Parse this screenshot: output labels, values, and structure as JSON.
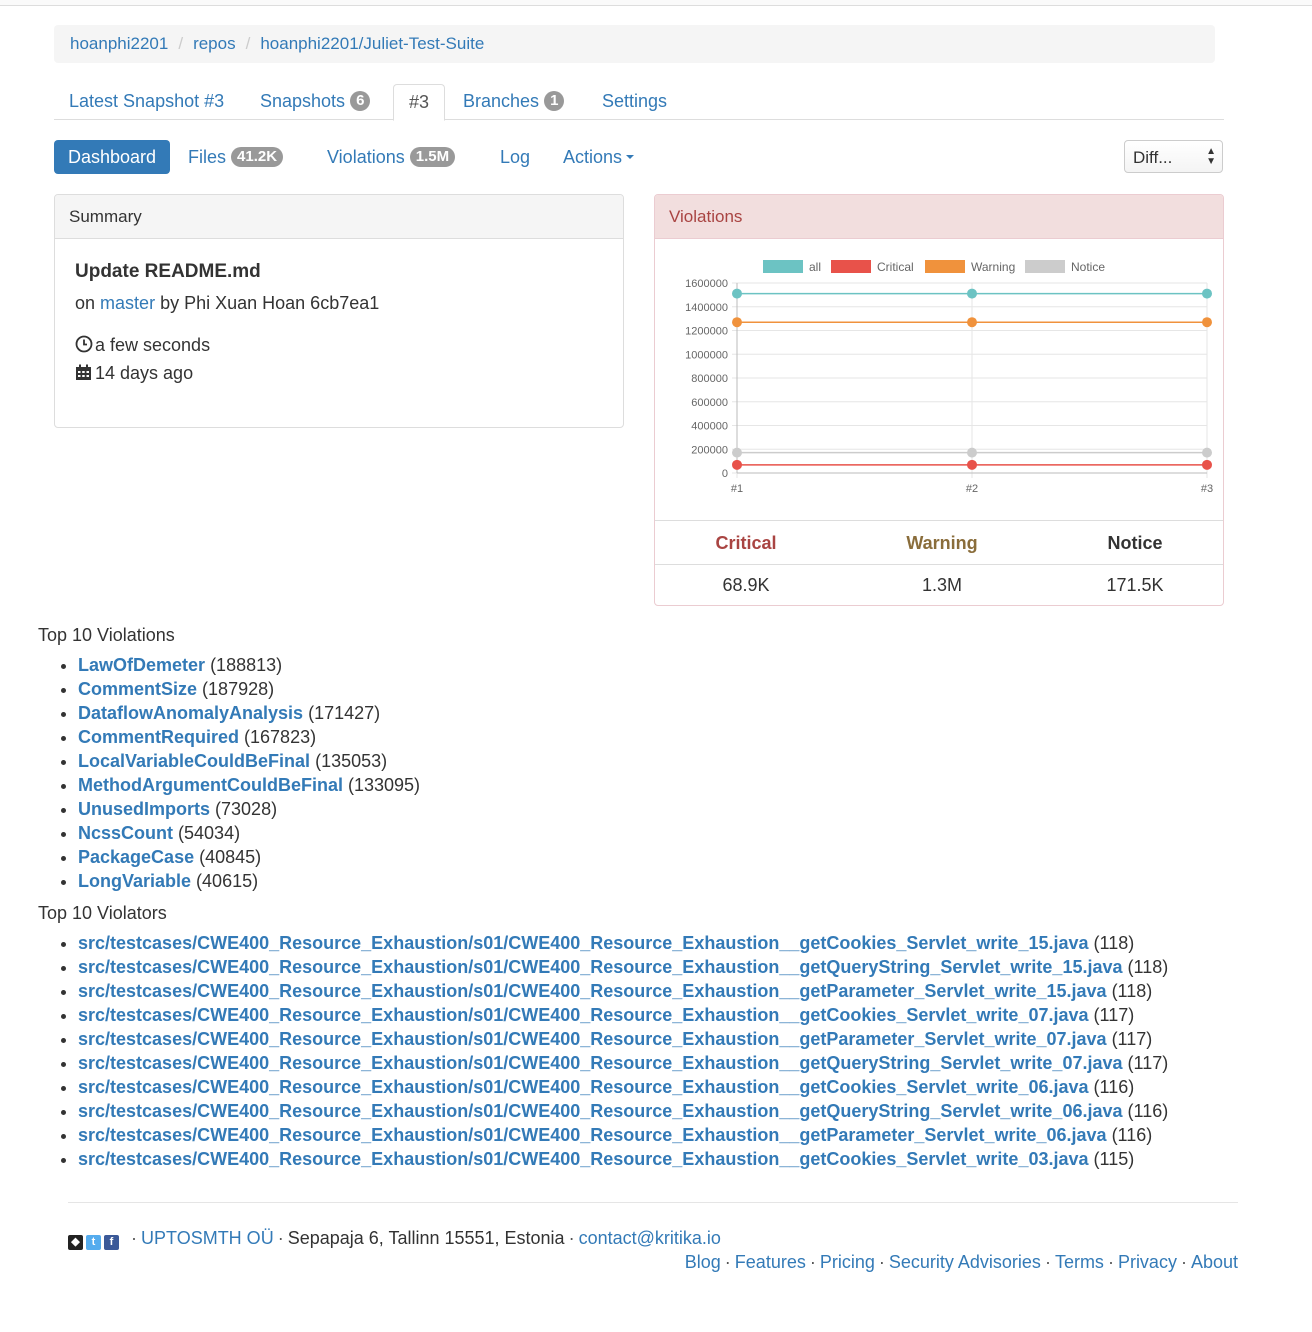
{
  "breadcrumb": [
    "hoanphi2201",
    "repos",
    "hoanphi2201/Juliet-Test-Suite"
  ],
  "tabs": {
    "latest": "Latest Snapshot #3",
    "snapshots": "Snapshots",
    "snapshots_count": "6",
    "current": "#3",
    "branches": "Branches",
    "branches_count": "1",
    "settings": "Settings"
  },
  "nav": {
    "dashboard": "Dashboard",
    "files": "Files",
    "files_count": "41.2K",
    "violations": "Violations",
    "violations_count": "1.5M",
    "log": "Log",
    "actions": "Actions"
  },
  "diff_select": "Diff...",
  "summary": {
    "heading": "Summary",
    "commit_title": "Update README.md",
    "on": "on",
    "branch": "master",
    "by": "by Phi Xuan Hoan 6cb7ea1",
    "duration": "a few seconds",
    "date": "14 days ago"
  },
  "violations_panel": {
    "heading": "Violations",
    "headers": {
      "critical": "Critical",
      "warning": "Warning",
      "notice": "Notice"
    },
    "values": {
      "critical": "68.9K",
      "warning": "1.3M",
      "notice": "171.5K"
    }
  },
  "chart_data": {
    "type": "line",
    "x": [
      "#1",
      "#2",
      "#3"
    ],
    "yticks": [
      "0",
      "200000",
      "400000",
      "600000",
      "800000",
      "1000000",
      "1200000",
      "1400000",
      "1600000"
    ],
    "ylim": [
      0,
      1600000
    ],
    "legend_position": "top",
    "grid": true,
    "series": [
      {
        "name": "all",
        "color": "#6cc3c3",
        "values": [
          1511000,
          1511000,
          1511000
        ]
      },
      {
        "name": "Critical",
        "color": "#e8524a",
        "values": [
          68900,
          68900,
          68900
        ]
      },
      {
        "name": "Warning",
        "color": "#f0923c",
        "values": [
          1270000,
          1270000,
          1270000
        ]
      },
      {
        "name": "Notice",
        "color": "#cccccc",
        "values": [
          171500,
          171500,
          171500
        ]
      }
    ]
  },
  "top_violations": {
    "title": "Top 10 Violations",
    "items": [
      {
        "name": "LawOfDemeter",
        "count": "(188813)"
      },
      {
        "name": "CommentSize",
        "count": "(187928)"
      },
      {
        "name": "DataflowAnomalyAnalysis",
        "count": "(171427)"
      },
      {
        "name": "CommentRequired",
        "count": "(167823)"
      },
      {
        "name": "LocalVariableCouldBeFinal",
        "count": "(135053)"
      },
      {
        "name": "MethodArgumentCouldBeFinal",
        "count": "(133095)"
      },
      {
        "name": "UnusedImports",
        "count": "(73028)"
      },
      {
        "name": "NcssCount",
        "count": "(54034)"
      },
      {
        "name": "PackageCase",
        "count": "(40845)"
      },
      {
        "name": "LongVariable",
        "count": "(40615)"
      }
    ]
  },
  "top_violators": {
    "title": "Top 10 Violators",
    "items": [
      {
        "name": "src/testcases/CWE400_Resource_Exhaustion/s01/CWE400_Resource_Exhaustion__getCookies_Servlet_write_15.java",
        "count": "(118)"
      },
      {
        "name": "src/testcases/CWE400_Resource_Exhaustion/s01/CWE400_Resource_Exhaustion__getQueryString_Servlet_write_15.java",
        "count": "(118)"
      },
      {
        "name": "src/testcases/CWE400_Resource_Exhaustion/s01/CWE400_Resource_Exhaustion__getParameter_Servlet_write_15.java",
        "count": "(118)"
      },
      {
        "name": "src/testcases/CWE400_Resource_Exhaustion/s01/CWE400_Resource_Exhaustion__getCookies_Servlet_write_07.java",
        "count": "(117)"
      },
      {
        "name": "src/testcases/CWE400_Resource_Exhaustion/s01/CWE400_Resource_Exhaustion__getParameter_Servlet_write_07.java",
        "count": "(117)"
      },
      {
        "name": "src/testcases/CWE400_Resource_Exhaustion/s01/CWE400_Resource_Exhaustion__getQueryString_Servlet_write_07.java",
        "count": "(117)"
      },
      {
        "name": "src/testcases/CWE400_Resource_Exhaustion/s01/CWE400_Resource_Exhaustion__getCookies_Servlet_write_06.java",
        "count": "(116)"
      },
      {
        "name": "src/testcases/CWE400_Resource_Exhaustion/s01/CWE400_Resource_Exhaustion__getQueryString_Servlet_write_06.java",
        "count": "(116)"
      },
      {
        "name": "src/testcases/CWE400_Resource_Exhaustion/s01/CWE400_Resource_Exhaustion__getParameter_Servlet_write_06.java",
        "count": "(116)"
      },
      {
        "name": "src/testcases/CWE400_Resource_Exhaustion/s01/CWE400_Resource_Exhaustion__getCookies_Servlet_write_03.java",
        "count": "(115)"
      }
    ]
  },
  "footer": {
    "social_icons": [
      "github-icon",
      "twitter-icon",
      "facebook-icon"
    ],
    "company": "UPTOSMTH OÜ",
    "address": "Sepapaja 6, Tallinn 15551, Estonia",
    "email": "contact@kritika.io",
    "links": [
      "Blog",
      "Features",
      "Pricing",
      "Security Advisories",
      "Terms",
      "Privacy",
      "About"
    ]
  }
}
